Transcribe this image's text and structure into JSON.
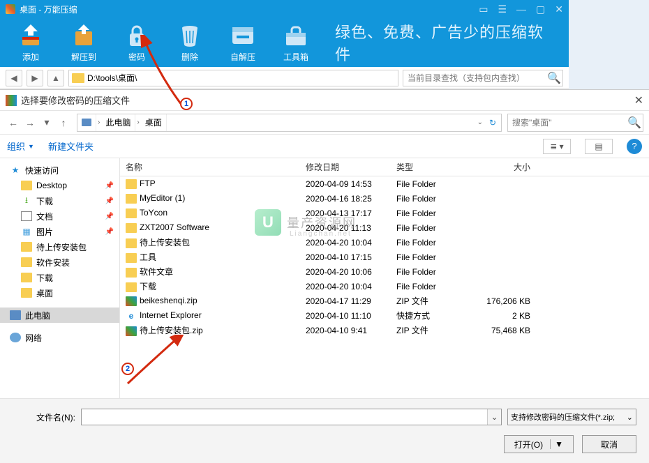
{
  "app": {
    "title": "桌面 - 万能压缩",
    "slogan": "绿色、免费、广告少的压缩软件",
    "toolbar": [
      {
        "id": "add",
        "label": "添加"
      },
      {
        "id": "extract",
        "label": "解压到"
      },
      {
        "id": "password",
        "label": "密码"
      },
      {
        "id": "delete",
        "label": "删除"
      },
      {
        "id": "sfx",
        "label": "自解压"
      },
      {
        "id": "toolbox",
        "label": "工具箱"
      }
    ],
    "path": "D:\\tools\\桌面\\",
    "search_placeholder": "当前目录查找（支持包内查找）"
  },
  "dialog": {
    "title": "选择要修改密码的压缩文件",
    "crumbs": [
      "此电脑",
      "桌面"
    ],
    "search_placeholder": "搜索\"桌面\"",
    "cmd_organize": "组织",
    "cmd_newfolder": "新建文件夹",
    "tree": [
      {
        "label": "快速访问",
        "icon": "star",
        "lv": 1
      },
      {
        "label": "Desktop",
        "icon": "fold",
        "lv": 2,
        "pin": true
      },
      {
        "label": "下载",
        "icon": "dl",
        "lv": 2,
        "pin": true
      },
      {
        "label": "文档",
        "icon": "doc",
        "lv": 2,
        "pin": true
      },
      {
        "label": "图片",
        "icon": "pic",
        "lv": 2,
        "pin": true
      },
      {
        "label": "待上传安装包",
        "icon": "fold",
        "lv": 2
      },
      {
        "label": "软件安装",
        "icon": "fold",
        "lv": 2
      },
      {
        "label": "下载",
        "icon": "fold",
        "lv": 2
      },
      {
        "label": "桌面",
        "icon": "fold",
        "lv": 2
      },
      {
        "label": "此电脑",
        "icon": "pc",
        "lv": 1,
        "sel": true
      },
      {
        "label": "网络",
        "icon": "net",
        "lv": 1
      }
    ],
    "columns": {
      "name": "名称",
      "date": "修改日期",
      "type": "类型",
      "size": "大小"
    },
    "rows": [
      {
        "name": "FTP",
        "date": "2020-04-09 14:53",
        "type": "File Folder",
        "size": "",
        "ic": "fold"
      },
      {
        "name": "MyEditor (1)",
        "date": "2020-04-16 18:25",
        "type": "File Folder",
        "size": "",
        "ic": "fold"
      },
      {
        "name": "ToYcon",
        "date": "2020-04-13 17:17",
        "type": "File Folder",
        "size": "",
        "ic": "fold"
      },
      {
        "name": "ZXT2007 Software",
        "date": "2020-04-20 11:13",
        "type": "File Folder",
        "size": "",
        "ic": "fold"
      },
      {
        "name": "待上传安装包",
        "date": "2020-04-20 10:04",
        "type": "File Folder",
        "size": "",
        "ic": "fold"
      },
      {
        "name": "工具",
        "date": "2020-04-10 17:15",
        "type": "File Folder",
        "size": "",
        "ic": "fold"
      },
      {
        "name": "软件文章",
        "date": "2020-04-20 10:06",
        "type": "File Folder",
        "size": "",
        "ic": "fold"
      },
      {
        "name": "下载",
        "date": "2020-04-20 10:04",
        "type": "File Folder",
        "size": "",
        "ic": "fold"
      },
      {
        "name": "beikeshenqi.zip",
        "date": "2020-04-17 11:29",
        "type": "ZIP 文件",
        "size": "176,206 KB",
        "ic": "zip"
      },
      {
        "name": "Internet  Explorer",
        "date": "2020-04-10 11:10",
        "type": "快捷方式",
        "size": "2 KB",
        "ic": "ie"
      },
      {
        "name": "待上传安装包.zip",
        "date": "2020-04-10 9:41",
        "type": "ZIP 文件",
        "size": "75,468 KB",
        "ic": "zip"
      }
    ],
    "filename_label": "文件名(N):",
    "filter": "支持修改密码的压缩文件(*.zip;",
    "btn_open": "打开(O)",
    "btn_cancel": "取消"
  },
  "watermark": {
    "text": "量产资源网",
    "sub": "Liangchan.net"
  },
  "annotations": {
    "b1": "1",
    "b2": "2"
  }
}
